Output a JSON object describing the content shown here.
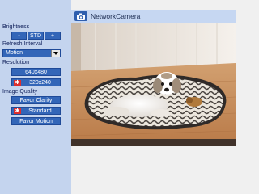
{
  "header": {
    "title": "NetworkCamera",
    "icon": "camera-icon"
  },
  "sidebar": {
    "brightness": {
      "label": "Brightness",
      "decrease": "-",
      "std": "STD",
      "increase": "+"
    },
    "refresh": {
      "label": "Refresh Interval",
      "selected": "Motion"
    },
    "resolution": {
      "label": "Resolution",
      "options": [
        "640x480",
        "320x240"
      ],
      "selected": "320x240"
    },
    "image_quality": {
      "label": "Image Quality",
      "options": [
        "Favor Clarity",
        "Standard",
        "Favor Motion"
      ],
      "selected": "Standard"
    }
  },
  "colors": {
    "sidebar_bg": "#c4d4ee",
    "button_bg": "#3366b8",
    "selected_marker": "#dc2e2e",
    "header_bg": "#c6d7f2"
  },
  "main": {
    "image": "camera-feed-dog-on-rug"
  }
}
